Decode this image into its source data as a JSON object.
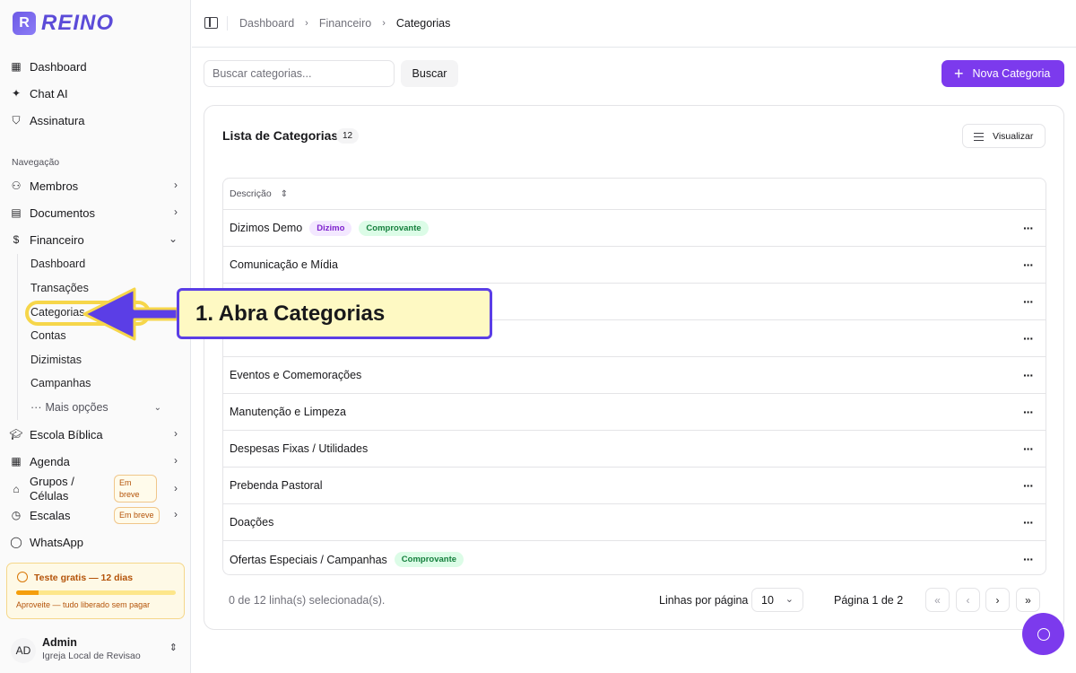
{
  "brand": {
    "name": "REINO",
    "mark": "R"
  },
  "sidebar": {
    "top_items": [
      {
        "label": "Dashboard",
        "icon": "dashboard-grid-icon"
      },
      {
        "label": "Chat AI",
        "icon": "sparkles-icon"
      },
      {
        "label": "Assinatura",
        "icon": "shield-check-icon"
      }
    ],
    "group_label": "Navegação",
    "nav": {
      "membros": "Membros",
      "documentos": "Documentos",
      "financeiro": "Financeiro",
      "financeiro_sub": [
        "Dashboard",
        "Transações",
        "Categorias",
        "Contas",
        "Dizimistas",
        "Campanhas"
      ],
      "more": "Mais opções",
      "escola": "Escola Bíblica",
      "agenda": "Agenda",
      "grupos": "Grupos / Células",
      "grupos_badge": "Em breve",
      "escalas": "Escalas",
      "escalas_badge": "Em breve",
      "whatsapp": "WhatsApp"
    },
    "trial": {
      "title": "Teste gratis — 12 dias",
      "subtitle": "Aproveite — tudo liberado sem pagar",
      "progress": 0.14
    },
    "user": {
      "initials": "AD",
      "name": "Admin",
      "org": "Igreja Local de Revisao"
    }
  },
  "breadcrumb": [
    "Dashboard",
    "Financeiro",
    "Categorias"
  ],
  "search": {
    "placeholder": "Buscar categorias...",
    "button": "Buscar"
  },
  "new_button": "Nova Categoria",
  "list": {
    "title": "Lista de Categorias",
    "count": "12",
    "view_button": "Visualizar",
    "column": "Descrição",
    "rows": [
      {
        "name": "Dizimos Demo",
        "tags": [
          "Dizimo",
          "Comprovante"
        ]
      },
      {
        "name": "Comunicação e Mídia",
        "tags": []
      },
      {
        "name": "",
        "tags": []
      },
      {
        "name": "",
        "tags": []
      },
      {
        "name": "Eventos e Comemorações",
        "tags": []
      },
      {
        "name": "Manutenção e Limpeza",
        "tags": []
      },
      {
        "name": "Despesas Fixas / Utilidades",
        "tags": []
      },
      {
        "name": "Prebenda Pastoral",
        "tags": []
      },
      {
        "name": "Doações",
        "tags": []
      },
      {
        "name": "Ofertas Especiais / Campanhas",
        "tags": [
          "Comprovante"
        ]
      }
    ],
    "selection_text": "0 de 12 linha(s) selecionada(s).",
    "rows_per_page_label": "Linhas por página",
    "rows_per_page": "10",
    "page_text": "Página 1 de 2"
  },
  "annotation": {
    "text": "1. Abra Categorias"
  },
  "colors": {
    "accent": "#7c3aed",
    "callout_border": "#5b3ee6",
    "callout_bg": "#fef9c3",
    "highlight": "#f6d64a"
  }
}
